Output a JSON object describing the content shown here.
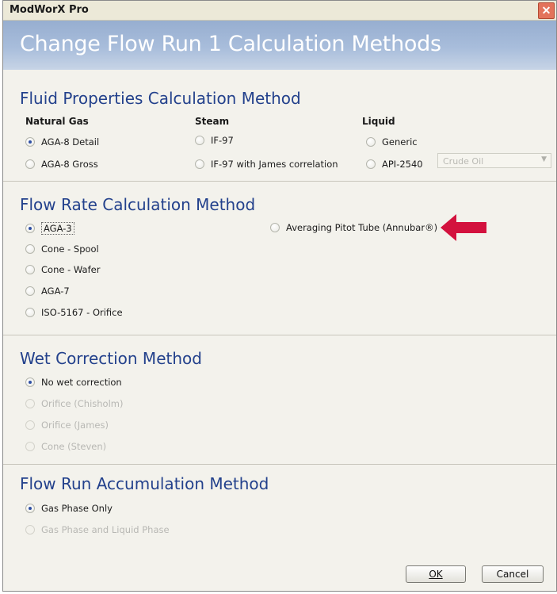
{
  "window": {
    "title": "ModWorX Pro",
    "close_icon": "x-icon"
  },
  "header": {
    "title": "Change Flow Run 1 Calculation Methods"
  },
  "fluid": {
    "title": "Fluid Properties Calculation Method",
    "natural_gas": {
      "heading": "Natural Gas",
      "options": [
        "AGA-8 Detail",
        "AGA-8 Gross"
      ]
    },
    "steam": {
      "heading": "Steam",
      "options": [
        "IF-97",
        "IF-97 with James correlation"
      ]
    },
    "liquid": {
      "heading": "Liquid",
      "options": [
        "Generic",
        "API-2540"
      ],
      "dropdown_value": "Crude Oil"
    },
    "selected": "AGA-8 Detail"
  },
  "flow_rate": {
    "title": "Flow Rate Calculation Method",
    "options": [
      "AGA-3",
      "Cone - Spool",
      "Cone - Wafer",
      "AGA-7",
      "ISO-5167 - Orifice",
      "Averaging Pitot Tube (Annubar®)"
    ],
    "selected": "AGA-3",
    "arrow_color": "#d3123e"
  },
  "wet": {
    "title": "Wet Correction Method",
    "options": [
      "No wet correction",
      "Orifice (Chisholm)",
      "Orifice (James)",
      "Cone (Steven)"
    ],
    "selected": "No wet correction"
  },
  "accumulation": {
    "title": "Flow Run Accumulation Method",
    "options": [
      "Gas Phase Only",
      "Gas Phase and Liquid Phase"
    ],
    "selected": "Gas Phase Only"
  },
  "buttons": {
    "ok": "OK",
    "cancel": "Cancel"
  }
}
